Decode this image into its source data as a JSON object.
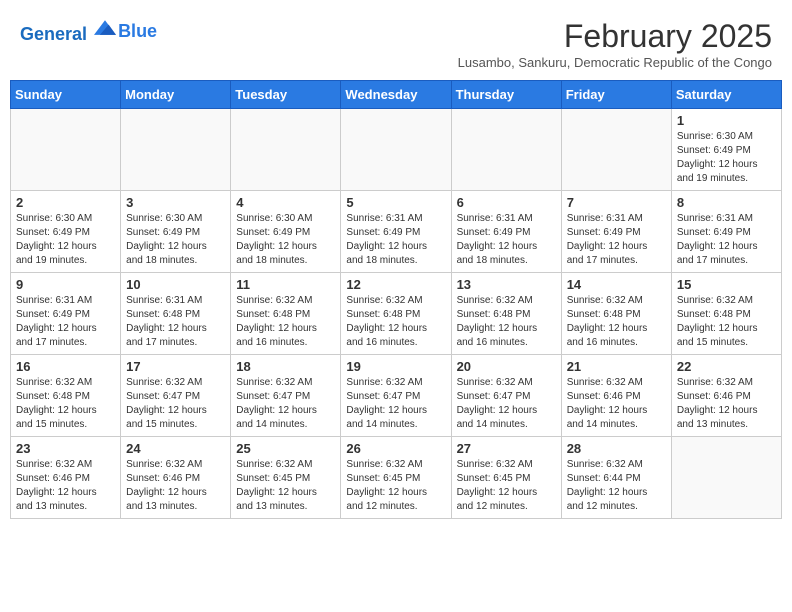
{
  "logo": {
    "line1": "General",
    "line2": "Blue"
  },
  "title": "February 2025",
  "subtitle": "Lusambo, Sankuru, Democratic Republic of the Congo",
  "days_of_week": [
    "Sunday",
    "Monday",
    "Tuesday",
    "Wednesday",
    "Thursday",
    "Friday",
    "Saturday"
  ],
  "weeks": [
    [
      {
        "day": "",
        "info": ""
      },
      {
        "day": "",
        "info": ""
      },
      {
        "day": "",
        "info": ""
      },
      {
        "day": "",
        "info": ""
      },
      {
        "day": "",
        "info": ""
      },
      {
        "day": "",
        "info": ""
      },
      {
        "day": "1",
        "info": "Sunrise: 6:30 AM\nSunset: 6:49 PM\nDaylight: 12 hours\nand 19 minutes."
      }
    ],
    [
      {
        "day": "2",
        "info": "Sunrise: 6:30 AM\nSunset: 6:49 PM\nDaylight: 12 hours\nand 19 minutes."
      },
      {
        "day": "3",
        "info": "Sunrise: 6:30 AM\nSunset: 6:49 PM\nDaylight: 12 hours\nand 18 minutes."
      },
      {
        "day": "4",
        "info": "Sunrise: 6:30 AM\nSunset: 6:49 PM\nDaylight: 12 hours\nand 18 minutes."
      },
      {
        "day": "5",
        "info": "Sunrise: 6:31 AM\nSunset: 6:49 PM\nDaylight: 12 hours\nand 18 minutes."
      },
      {
        "day": "6",
        "info": "Sunrise: 6:31 AM\nSunset: 6:49 PM\nDaylight: 12 hours\nand 18 minutes."
      },
      {
        "day": "7",
        "info": "Sunrise: 6:31 AM\nSunset: 6:49 PM\nDaylight: 12 hours\nand 17 minutes."
      },
      {
        "day": "8",
        "info": "Sunrise: 6:31 AM\nSunset: 6:49 PM\nDaylight: 12 hours\nand 17 minutes."
      }
    ],
    [
      {
        "day": "9",
        "info": "Sunrise: 6:31 AM\nSunset: 6:49 PM\nDaylight: 12 hours\nand 17 minutes."
      },
      {
        "day": "10",
        "info": "Sunrise: 6:31 AM\nSunset: 6:48 PM\nDaylight: 12 hours\nand 17 minutes."
      },
      {
        "day": "11",
        "info": "Sunrise: 6:32 AM\nSunset: 6:48 PM\nDaylight: 12 hours\nand 16 minutes."
      },
      {
        "day": "12",
        "info": "Sunrise: 6:32 AM\nSunset: 6:48 PM\nDaylight: 12 hours\nand 16 minutes."
      },
      {
        "day": "13",
        "info": "Sunrise: 6:32 AM\nSunset: 6:48 PM\nDaylight: 12 hours\nand 16 minutes."
      },
      {
        "day": "14",
        "info": "Sunrise: 6:32 AM\nSunset: 6:48 PM\nDaylight: 12 hours\nand 16 minutes."
      },
      {
        "day": "15",
        "info": "Sunrise: 6:32 AM\nSunset: 6:48 PM\nDaylight: 12 hours\nand 15 minutes."
      }
    ],
    [
      {
        "day": "16",
        "info": "Sunrise: 6:32 AM\nSunset: 6:48 PM\nDaylight: 12 hours\nand 15 minutes."
      },
      {
        "day": "17",
        "info": "Sunrise: 6:32 AM\nSunset: 6:47 PM\nDaylight: 12 hours\nand 15 minutes."
      },
      {
        "day": "18",
        "info": "Sunrise: 6:32 AM\nSunset: 6:47 PM\nDaylight: 12 hours\nand 14 minutes."
      },
      {
        "day": "19",
        "info": "Sunrise: 6:32 AM\nSunset: 6:47 PM\nDaylight: 12 hours\nand 14 minutes."
      },
      {
        "day": "20",
        "info": "Sunrise: 6:32 AM\nSunset: 6:47 PM\nDaylight: 12 hours\nand 14 minutes."
      },
      {
        "day": "21",
        "info": "Sunrise: 6:32 AM\nSunset: 6:46 PM\nDaylight: 12 hours\nand 14 minutes."
      },
      {
        "day": "22",
        "info": "Sunrise: 6:32 AM\nSunset: 6:46 PM\nDaylight: 12 hours\nand 13 minutes."
      }
    ],
    [
      {
        "day": "23",
        "info": "Sunrise: 6:32 AM\nSunset: 6:46 PM\nDaylight: 12 hours\nand 13 minutes."
      },
      {
        "day": "24",
        "info": "Sunrise: 6:32 AM\nSunset: 6:46 PM\nDaylight: 12 hours\nand 13 minutes."
      },
      {
        "day": "25",
        "info": "Sunrise: 6:32 AM\nSunset: 6:45 PM\nDaylight: 12 hours\nand 13 minutes."
      },
      {
        "day": "26",
        "info": "Sunrise: 6:32 AM\nSunset: 6:45 PM\nDaylight: 12 hours\nand 12 minutes."
      },
      {
        "day": "27",
        "info": "Sunrise: 6:32 AM\nSunset: 6:45 PM\nDaylight: 12 hours\nand 12 minutes."
      },
      {
        "day": "28",
        "info": "Sunrise: 6:32 AM\nSunset: 6:44 PM\nDaylight: 12 hours\nand 12 minutes."
      },
      {
        "day": "",
        "info": ""
      }
    ]
  ]
}
